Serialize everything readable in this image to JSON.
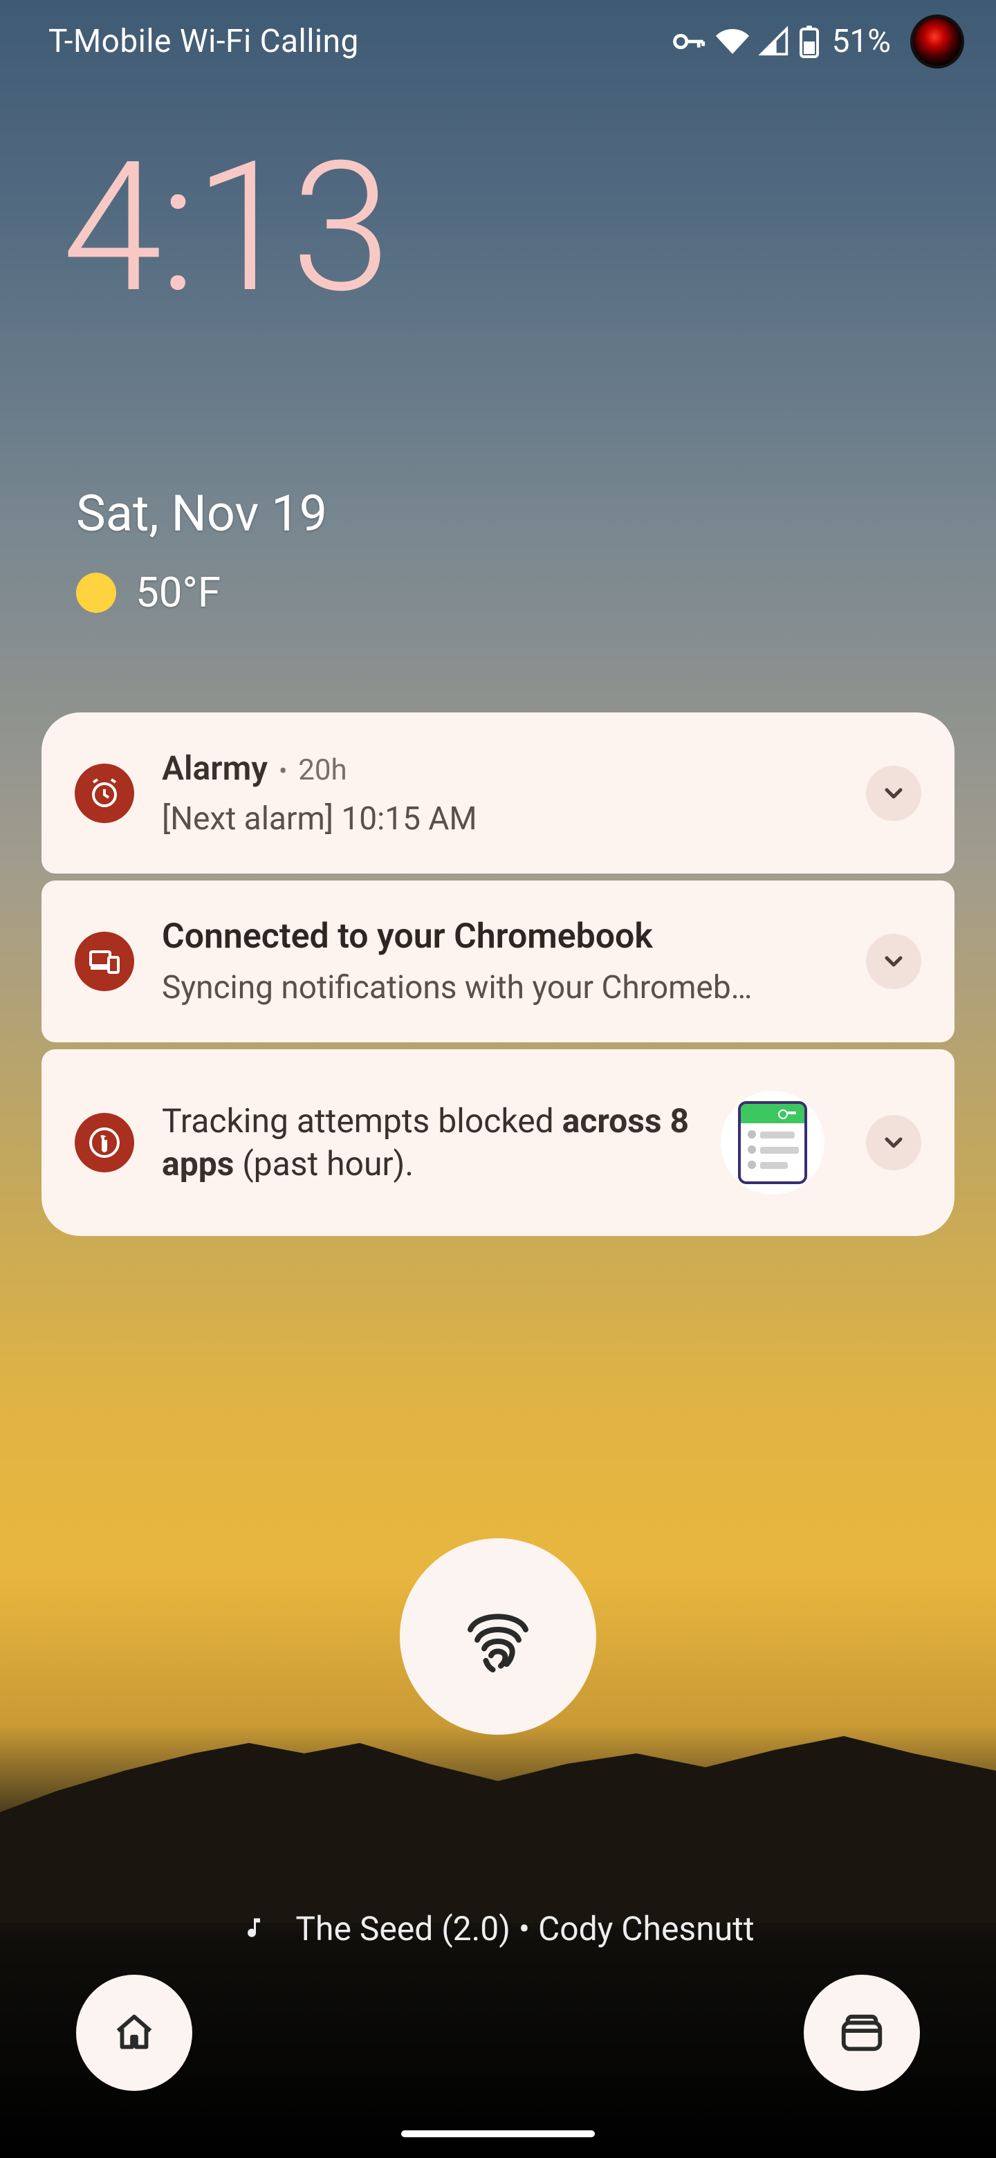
{
  "status": {
    "carrier": "T-Mobile Wi-Fi Calling",
    "battery_pct": "51%"
  },
  "clock": {
    "time": "4:13",
    "date": "Sat, Nov 19"
  },
  "weather": {
    "temp": "50°F"
  },
  "notifications": {
    "alarmy": {
      "app": "Alarmy",
      "age": "20h",
      "body": "[Next alarm] 10:15 AM"
    },
    "chromebook": {
      "title": "Connected to your Chromebook",
      "body": "Syncing notifications with your Chromeb…"
    },
    "duckduckgo": {
      "prefix": "Tracking attempts blocked ",
      "bold": "across 8 apps",
      "suffix": " (past hour)."
    }
  },
  "now_playing": {
    "text": "The Seed (2.0) • Cody Chesnutt"
  }
}
